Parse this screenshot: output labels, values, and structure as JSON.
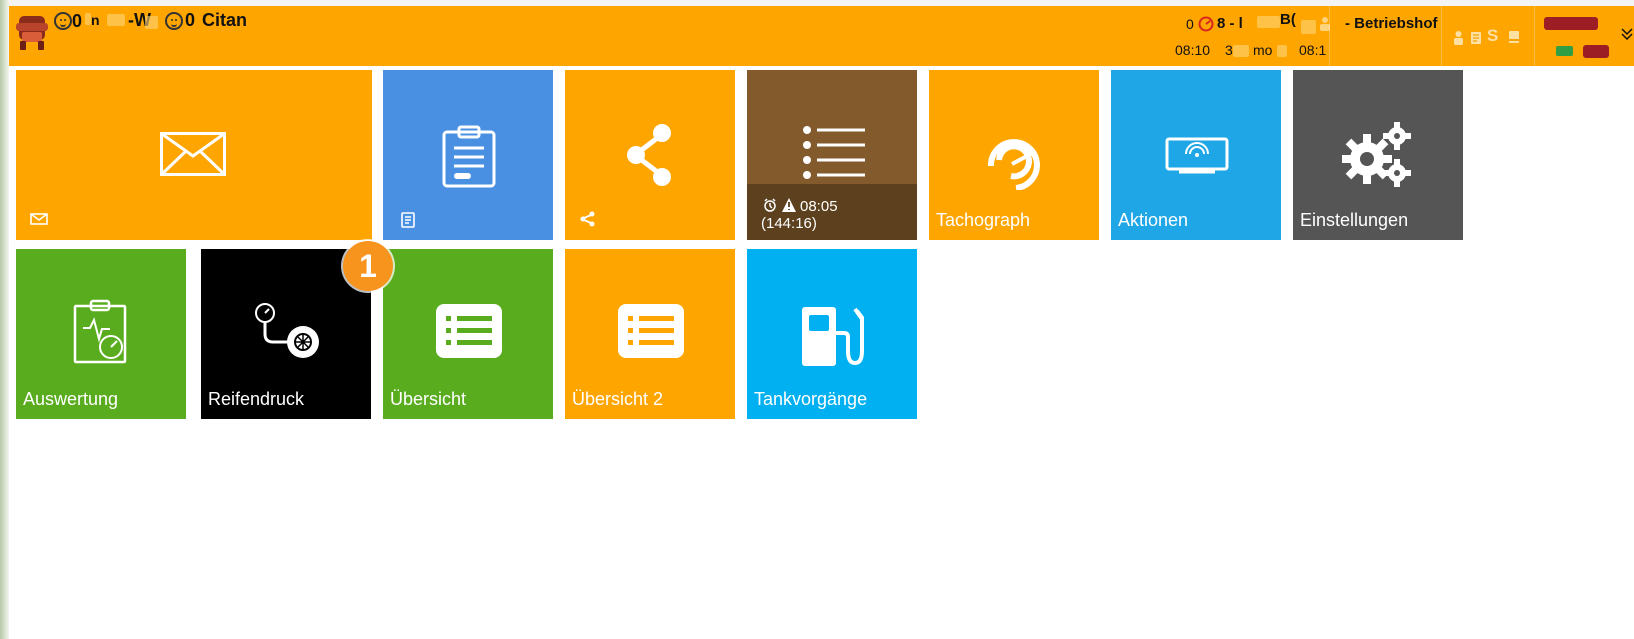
{
  "colors": {
    "topbar": "#ffa500",
    "orange": "#ffa500",
    "blue": "#4a90e2",
    "brown": "#825a2c",
    "cyan": "#1ea6e6",
    "gray": "#555555",
    "green": "#5aac1f",
    "black": "#000000",
    "tank_blue": "#00b0f0",
    "badge_orange": "#f7941d"
  },
  "header": {
    "left_prefix": "0",
    "left_partial": "n",
    "left_middle": "-W",
    "left_counter": "0",
    "vehicle_name": "Citan",
    "speed_count": "0",
    "route_text": "8 - l",
    "route_code": "B(",
    "depot": "- Betriebshof",
    "time_left": "08:10",
    "date_partial": "3",
    "month_partial": "mo",
    "time_right": "08:1",
    "status_mark": "S"
  },
  "tiles": {
    "nachrichten": {
      "icon": "envelope-icon",
      "small_icon": "envelope-small-icon"
    },
    "formular": {
      "icon": "clipboard-icon",
      "small_icon": "clipboard-small-icon"
    },
    "teilen": {
      "icon": "share-icon",
      "small_icon": "share-small-icon"
    },
    "auftraege": {
      "icon": "numbered-list-icon",
      "time": "08:05",
      "duration": "(144:16)"
    },
    "tachograph": {
      "label": "Tachograph",
      "icon": "tachograph-icon"
    },
    "aktionen": {
      "label": "Aktionen",
      "icon": "tablet-wireless-icon"
    },
    "einstellungen": {
      "label": "Einstellungen",
      "icon": "gears-icon"
    },
    "auswertung": {
      "label": "Auswertung",
      "icon": "evaluation-clipboard-icon"
    },
    "reifendruck": {
      "label": "Reifendruck",
      "icon": "tire-pressure-icon"
    },
    "uebersicht": {
      "label": "Übersicht",
      "icon": "list-card-icon"
    },
    "uebersicht2": {
      "label": "Übersicht 2",
      "icon": "list-card-icon"
    },
    "tankvorgaenge": {
      "label": "Tankvorgänge",
      "icon": "fuel-pump-icon"
    }
  },
  "badge": {
    "number": "1"
  }
}
